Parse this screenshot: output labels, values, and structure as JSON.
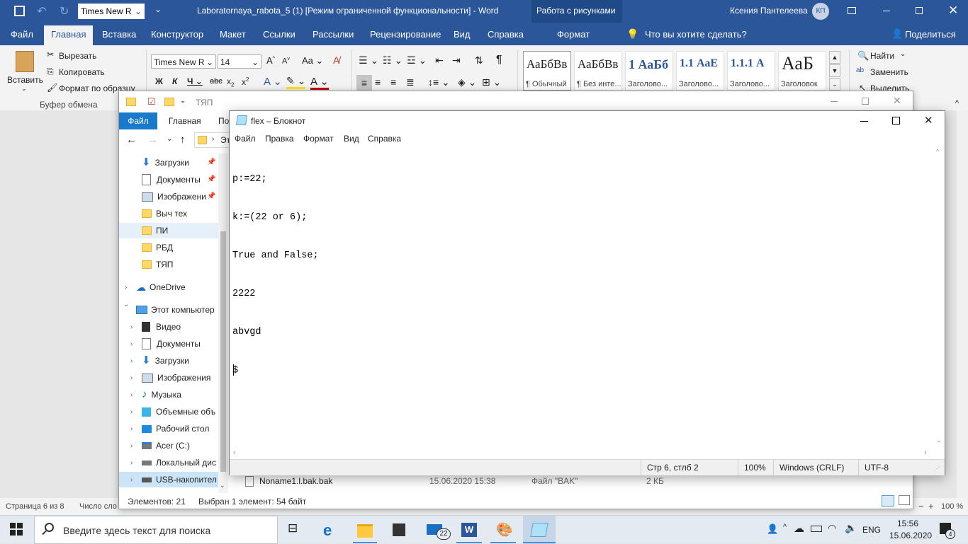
{
  "word": {
    "title": "Laboratornaya_rabota_5 (1) [Режим ограниченной функциональности]  -  Word",
    "context_tab_title": "Работа с рисунками",
    "user_name": "Ксения Пантелеева",
    "user_initials": "КП",
    "quick_font": "Times New R",
    "tabs": [
      "Файл",
      "Главная",
      "Вставка",
      "Конструктор",
      "Макет",
      "Ссылки",
      "Рассылки",
      "Рецензирование",
      "Вид",
      "Справка",
      "Формат"
    ],
    "tell_me": "Что вы хотите сделать?",
    "share": "Поделиться",
    "clipboard": {
      "paste": "Вставить",
      "cut": "Вырезать",
      "copy": "Копировать",
      "format_painter": "Формат по образцу",
      "group": "Буфер обмена"
    },
    "font": {
      "name": "Times New R",
      "size": "14"
    },
    "styles": [
      {
        "preview": "АаБбВв",
        "name": "¶ Обычный"
      },
      {
        "preview": "АаБбВв",
        "name": "¶ Без инте..."
      },
      {
        "preview": "1  АаБб",
        "name": "Заголово..."
      },
      {
        "preview": "1.1  АаЕ",
        "name": "Заголово..."
      },
      {
        "preview": "1.1.1  А",
        "name": "Заголово..."
      },
      {
        "preview": "АаБ",
        "name": "Заголовок"
      }
    ],
    "editing": {
      "find": "Найти",
      "replace": "Заменить",
      "select": "Выделить"
    },
    "status": {
      "page": "Страница 6 из 8",
      "words": "Число сло",
      "zoom": "100 %"
    }
  },
  "explorer": {
    "path_title": "ТЯП",
    "tabs": [
      "Файл",
      "Главная",
      "По"
    ],
    "address_prefix": "Эт",
    "nav": {
      "quick": [
        {
          "label": "Загрузки",
          "icon": "download-icon",
          "pinned": true
        },
        {
          "label": "Документы",
          "icon": "document-icon",
          "pinned": true
        },
        {
          "label": "Изображени",
          "icon": "image-icon",
          "pinned": true
        },
        {
          "label": "Выч тех",
          "icon": "folder-icon",
          "pinned": false
        },
        {
          "label": "ПИ",
          "icon": "folder-icon",
          "pinned": false
        },
        {
          "label": "РБД",
          "icon": "folder-icon",
          "pinned": false
        },
        {
          "label": "ТЯП",
          "icon": "folder-icon",
          "pinned": false
        }
      ],
      "onedrive": "OneDrive",
      "this_pc": "Этот компьютер",
      "pc_items": [
        {
          "label": "Видео",
          "icon": "video-icon"
        },
        {
          "label": "Документы",
          "icon": "document-icon"
        },
        {
          "label": "Загрузки",
          "icon": "download-icon"
        },
        {
          "label": "Изображения",
          "icon": "image-icon"
        },
        {
          "label": "Музыка",
          "icon": "music-icon"
        },
        {
          "label": "Объемные объ",
          "icon": "3d-objects-icon"
        },
        {
          "label": "Рабочий стол",
          "icon": "desktop-icon"
        },
        {
          "label": "Acer (C:)",
          "icon": "drive-icon"
        },
        {
          "label": "Локальный дис",
          "icon": "drive-icon"
        },
        {
          "label": "USB-накопител",
          "icon": "usb-drive-icon"
        }
      ]
    },
    "file_row": {
      "name": "Noname1.l.bak.bak",
      "date": "15.06.2020 15:38",
      "type": "Файл \"BAK\"",
      "size": "2 КБ"
    },
    "status": {
      "count": "Элементов: 21",
      "selected": "Выбран 1 элемент: 54 байт"
    }
  },
  "notepad": {
    "title": "flex – Блокнот",
    "menu": [
      "Файл",
      "Правка",
      "Формат",
      "Вид",
      "Справка"
    ],
    "lines": [
      "p:=22;",
      "k:=(22 or 6);",
      "True and False;",
      "2222",
      "abvgd",
      "$"
    ],
    "status": {
      "position": "Стр 6, стлб 2",
      "zoom": "100%",
      "eol": "Windows (CRLF)",
      "encoding": "UTF-8"
    }
  },
  "taskbar": {
    "search_placeholder": "Введите здесь текст для поиска",
    "mail_badge": "22",
    "language": "ENG",
    "time": "15:56",
    "date": "15.06.2020",
    "notification_count": "4"
  }
}
